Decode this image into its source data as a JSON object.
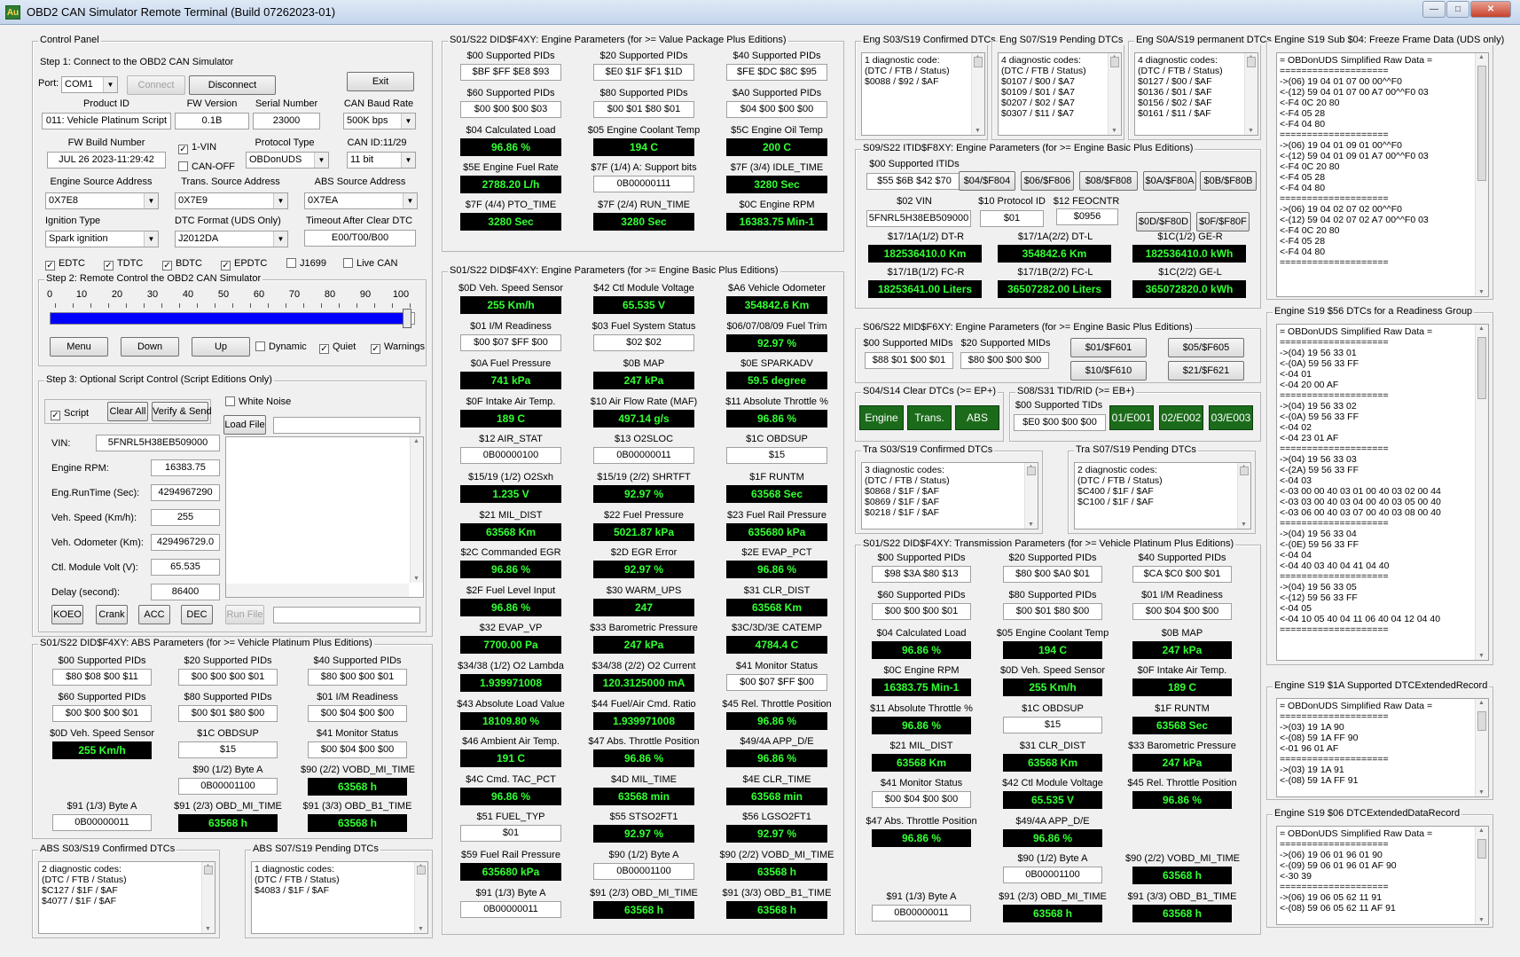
{
  "window": {
    "title": "OBD2 CAN Simulator Remote Terminal (Build 07262023-01)",
    "icon": "Au",
    "min": "—",
    "max": "□",
    "close": "✕"
  },
  "control": {
    "title": "Control Panel",
    "step1": "Step 1: Connect to the OBD2 CAN Simulator",
    "port_label": "Port:",
    "port_value": "COM1",
    "connect": "Connect",
    "disconnect": "Disconnect",
    "exit": "Exit",
    "product_id_label": "Product ID",
    "product_id": "011: Vehicle Platinum Script",
    "fw_version_label": "FW Version",
    "fw_version": "0.1B",
    "serial_label": "Serial Number",
    "serial": "23000",
    "baud_label": "CAN Baud Rate",
    "baud": "500K bps",
    "fw_build_label": "FW Build Number",
    "fw_build": "JUL 26 2023-11:29:42",
    "vin1": "1-VIN",
    "canoff": "CAN-OFF",
    "protocol_label": "Protocol Type",
    "protocol": "OBDonUDS",
    "canid_label": "CAN ID:11/29",
    "canid": "11 bit",
    "eng_src_label": "Engine Source Address",
    "eng_src": "0X7E8",
    "trans_src_label": "Trans. Source Address",
    "trans_src": "0X7E9",
    "abs_src_label": "ABS Source Address",
    "abs_src": "0X7EA",
    "ign_label": "Ignition Type",
    "ign": "Spark ignition",
    "dtc_fmt_label": "DTC Format (UDS Only)",
    "dtc_fmt": "J2012DA",
    "timeout_label": "Timeout After Clear DTC",
    "timeout": "E00/T00/B00",
    "checks": [
      {
        "label": "EDTC",
        "on": true
      },
      {
        "label": "TDTC",
        "on": true
      },
      {
        "label": "BDTC",
        "on": true
      },
      {
        "label": "EPDTC",
        "on": true
      },
      {
        "label": "J1699",
        "on": false
      },
      {
        "label": "Live CAN",
        "on": false
      }
    ],
    "step2": "Step 2: Remote Control the OBD2 CAN Simulator",
    "ticks": [
      "0",
      "10",
      "20",
      "30",
      "40",
      "50",
      "60",
      "70",
      "80",
      "90",
      "100"
    ],
    "slider_value": 98,
    "menu": "Menu",
    "down": "Down",
    "up": "Up",
    "dynamic": "Dynamic",
    "quiet": "Quiet",
    "warnings": "Warnings",
    "step3": "Step 3: Optional Script Control (Script Editions Only)",
    "white_noise": "White Noise",
    "script": "Script",
    "clear_all": "Clear All",
    "verify_send": "Verify & Send",
    "load_file": "Load File",
    "vin_label": "VIN:",
    "vin": "5FNRL5H38EB509000",
    "rpm_label": "Engine RPM:",
    "rpm": "16383.75",
    "runtime_label": "Eng.RunTime (Sec):",
    "runtime": "4294967290",
    "speed_label": "Veh. Speed (Km/h):",
    "speed": "255",
    "odo_label": "Veh. Odometer (Km):",
    "odo": "429496729.0",
    "ctl_label": "Ctl. Module Volt (V):",
    "ctl": "65.535",
    "delay_label": "Delay (second):",
    "delay": "86400",
    "koeo": "KOEO",
    "crank": "Crank",
    "acc": "ACC",
    "dec": "DEC",
    "run_file": "Run File"
  },
  "abs": {
    "title": "S01/S22 DID$F4XY: ABS Parameters (for >= Vehicle Platinum Plus Editions)",
    "cells": [
      {
        "l": "$00 Supported PIDs",
        "v": "$80 $08 $00 $11",
        "g": false
      },
      {
        "l": "$20 Supported PIDs",
        "v": "$00 $00 $00 $01",
        "g": false
      },
      {
        "l": "$40 Supported PIDs",
        "v": "$80 $00 $00 $01",
        "g": false
      },
      {
        "l": "$60 Supported PIDs",
        "v": "$00 $00 $00 $01",
        "g": false
      },
      {
        "l": "$80 Supported PIDs",
        "v": "$00 $01 $80 $00",
        "g": false
      },
      {
        "l": "$01 I/M Readiness",
        "v": "$00 $04 $00 $00",
        "g": false
      },
      {
        "l": "$0D Veh. Speed Sensor",
        "v": "255 Km/h",
        "g": true
      },
      {
        "l": "$1C OBDSUP",
        "v": "$15",
        "g": false
      },
      {
        "l": "$41 Monitor Status",
        "v": "$00 $04 $00 $00",
        "g": false
      },
      {
        "l": "",
        "v": "",
        "g": false
      },
      {
        "l": "$90 (1/2) Byte A",
        "v": "0B00001100",
        "g": false
      },
      {
        "l": "$90 (2/2) VOBD_MI_TIME",
        "v": "63568 h",
        "g": true
      },
      {
        "l": "$91 (1/3) Byte A",
        "v": "0B00000011",
        "g": false
      },
      {
        "l": "$91 (2/3) OBD_MI_TIME",
        "v": "63568 h",
        "g": true
      },
      {
        "l": "$91 (3/3) OBD_B1_TIME",
        "v": "63568 h",
        "g": true
      }
    ],
    "confirmed_title": "ABS S03/S19 Confirmed DTCs",
    "confirmed": "2 diagnostic codes:\n(DTC / FTB / Status)\n$C127 / $1F / $AF\n$4077 / $1F / $AF",
    "pending_title": "ABS S07/S19 Pending DTCs",
    "pending": "1 diagnostic codes:\n(DTC / FTB / Status)\n$4083 / $1F / $AF"
  },
  "value_pkg": {
    "title": "S01/S22 DID$F4XY: Engine Parameters (for >= Value Package Plus Editions)",
    "cells": [
      {
        "l": "$00 Supported PIDs",
        "v": "$BF $FF $E8 $93",
        "g": false
      },
      {
        "l": "$20 Supported PIDs",
        "v": "$E0 $1F $F1 $1D",
        "g": false
      },
      {
        "l": "$40 Supported PIDs",
        "v": "$FE $DC $8C $95",
        "g": false
      },
      {
        "l": "$60 Supported PIDs",
        "v": "$00 $00 $00 $03",
        "g": false
      },
      {
        "l": "$80 Supported PIDs",
        "v": "$00 $01 $80 $01",
        "g": false
      },
      {
        "l": "$A0 Supported PIDs",
        "v": "$04 $00 $00 $00",
        "g": false
      },
      {
        "l": "$04 Calculated Load",
        "v": "96.86 %",
        "g": true
      },
      {
        "l": "$05 Engine Coolant Temp",
        "v": "194 C",
        "g": true
      },
      {
        "l": "$5C Engine Oil Temp",
        "v": "200 C",
        "g": true
      },
      {
        "l": "$5E Engine Fuel Rate",
        "v": "2788.20 L/h",
        "g": true
      },
      {
        "l": "$7F (1/4) A: Support bits",
        "v": "0B00000111",
        "g": false
      },
      {
        "l": "$7F (3/4) IDLE_TIME",
        "v": "3280 Sec",
        "g": true
      },
      {
        "l": "$7F (4/4) PTO_TIME",
        "v": "3280 Sec",
        "g": true
      },
      {
        "l": "$7F (2/4) RUN_TIME",
        "v": "3280 Sec",
        "g": true
      },
      {
        "l": "$0C Engine RPM",
        "v": "16383.75 Min-1",
        "g": true
      }
    ]
  },
  "basic": {
    "title": "S01/S22 DID$F4XY: Engine Parameters (for >= Engine Basic Plus Editions)",
    "cells": [
      {
        "l": "$0D Veh. Speed Sensor",
        "v": "255 Km/h",
        "g": true
      },
      {
        "l": "$42 Ctl Module Voltage",
        "v": "65.535 V",
        "g": true
      },
      {
        "l": "$A6 Vehicle Odometer",
        "v": "354842.6 Km",
        "g": true
      },
      {
        "l": "$01 I/M Readiness",
        "v": "$00 $07 $FF $00",
        "g": false
      },
      {
        "l": "$03 Fuel System Status",
        "v": "$02 $02",
        "g": false
      },
      {
        "l": "$06/07/08/09 Fuel Trim",
        "v": "92.97 %",
        "g": true
      },
      {
        "l": "$0A Fuel Pressure",
        "v": "741 kPa",
        "g": true
      },
      {
        "l": "$0B MAP",
        "v": "247 kPa",
        "g": true
      },
      {
        "l": "$0E SPARKADV",
        "v": "59.5 degree",
        "g": true
      },
      {
        "l": "$0F Intake Air Temp.",
        "v": "189 C",
        "g": true
      },
      {
        "l": "$10 Air Flow Rate (MAF)",
        "v": "497.14 g/s",
        "g": true
      },
      {
        "l": "$11 Absolute Throttle %",
        "v": "96.86 %",
        "g": true
      },
      {
        "l": "$12 AIR_STAT",
        "v": "0B00000100",
        "g": false
      },
      {
        "l": "$13 O2SLOC",
        "v": "0B00000011",
        "g": false
      },
      {
        "l": "$1C OBDSUP",
        "v": "$15",
        "g": false
      },
      {
        "l": "$15/19 (1/2) O2Sxh",
        "v": "1.235 V",
        "g": true
      },
      {
        "l": "$15/19 (2/2) SHRTFT",
        "v": "92.97 %",
        "g": true
      },
      {
        "l": "$1F RUNTM",
        "v": "63568 Sec",
        "g": true
      },
      {
        "l": "$21 MIL_DIST",
        "v": "63568 Km",
        "g": true
      },
      {
        "l": "$22 Fuel Pressure",
        "v": "5021.87 kPa",
        "g": true
      },
      {
        "l": "$23 Fuel Rail Pressure",
        "v": "635680 kPa",
        "g": true
      },
      {
        "l": "$2C Commanded EGR",
        "v": "96.86 %",
        "g": true
      },
      {
        "l": "$2D EGR Error",
        "v": "92.97 %",
        "g": true
      },
      {
        "l": "$2E EVAP_PCT",
        "v": "96.86 %",
        "g": true
      },
      {
        "l": "$2F Fuel Level Input",
        "v": "96.86 %",
        "g": true
      },
      {
        "l": "$30 WARM_UPS",
        "v": "247",
        "g": true
      },
      {
        "l": "$31 CLR_DIST",
        "v": "63568 Km",
        "g": true
      },
      {
        "l": "$32 EVAP_VP",
        "v": "7700.00 Pa",
        "g": true
      },
      {
        "l": "$33 Barometric Pressure",
        "v": "247 kPa",
        "g": true
      },
      {
        "l": "$3C/3D/3E CATEMP",
        "v": "4784.4 C",
        "g": true
      },
      {
        "l": "$34/38 (1/2) O2 Lambda",
        "v": "1.939971008",
        "g": true
      },
      {
        "l": "$34/38 (2/2) O2 Current",
        "v": "120.3125000 mA",
        "g": true
      },
      {
        "l": "$41 Monitor Status",
        "v": "$00 $07 $FF $00",
        "g": false
      },
      {
        "l": "$43 Absolute Load Value",
        "v": "18109.80 %",
        "g": true
      },
      {
        "l": "$44 Fuel/Air Cmd. Ratio",
        "v": "1.939971008",
        "g": true
      },
      {
        "l": "$45 Rel. Throttle Position",
        "v": "96.86 %",
        "g": true
      },
      {
        "l": "$46 Ambient Air Temp.",
        "v": "191 C",
        "g": true
      },
      {
        "l": "$47 Abs. Throttle Position",
        "v": "96.86 %",
        "g": true
      },
      {
        "l": "$49/4A APP_D/E",
        "v": "96.86 %",
        "g": true
      },
      {
        "l": "$4C Cmd. TAC_PCT",
        "v": "96.86 %",
        "g": true
      },
      {
        "l": "$4D MIL_TIME",
        "v": "63568 min",
        "g": true
      },
      {
        "l": "$4E CLR_TIME",
        "v": "63568 min",
        "g": true
      },
      {
        "l": "$51 FUEL_TYP",
        "v": "$01",
        "g": false
      },
      {
        "l": "$55 STSO2FT1",
        "v": "92.97 %",
        "g": true
      },
      {
        "l": "$56 LGSO2FT1",
        "v": "92.97 %",
        "g": true
      },
      {
        "l": "$59 Fuel Rail Pressure",
        "v": "635680 kPa",
        "g": true
      },
      {
        "l": "$90 (1/2) Byte A",
        "v": "0B00001100",
        "g": false
      },
      {
        "l": "$90 (2/2) VOBD_MI_TIME",
        "v": "63568 h",
        "g": true
      },
      {
        "l": "$91 (1/3) Byte A",
        "v": "0B00000011",
        "g": false
      },
      {
        "l": "$91 (2/3) OBD_MI_TIME",
        "v": "63568 h",
        "g": true
      },
      {
        "l": "$91 (3/3) OBD_B1_TIME",
        "v": "63568 h",
        "g": true
      }
    ]
  },
  "eng_dtc": {
    "confirmed_title": "Eng S03/S19 Confirmed DTCs",
    "confirmed": "1 diagnostic code:\n(DTC / FTB / Status)\n$0088 / $92 / $AF",
    "pending_title": "Eng S07/S19 Pending DTCs",
    "pending": "4 diagnostic codes:\n(DTC / FTB / Status)\n$0107 / $00 / $A7\n$0109 / $01 / $A7\n$0207 / $02 / $A7\n$0307 / $11 / $A7",
    "perm_title": "Eng S0A/S19 permanent DTCs",
    "perm": "4 diagnostic codes:\n(DTC / FTB / Status)\n$0127 / $00 / $AF\n$0136 / $01 / $AF\n$0156 / $02 / $AF\n$0161 / $11 / $AF"
  },
  "itid": {
    "title": "S09/S22 ITID$F8XY: Engine Parameters (for >= Engine Basic Plus Editions)",
    "sup_label": "$00 Supported ITIDs",
    "sup": "$55 $6B $42 $70",
    "btns": [
      "$04/$F804",
      "$06/$F806",
      "$08/$F808",
      "$0A/$F80A",
      "$0B/$F80B"
    ],
    "vin_label": "$02 VIN",
    "vin": "5FNRL5H38EB509000",
    "proto_label": "$10 Protocol ID",
    "proto": "$01",
    "feo_label": "$12 FEOCNTR",
    "feo": "$0956",
    "btns2": [
      "$0D/$F80D",
      "$0F/$F80F"
    ],
    "cells": [
      {
        "l": "$17/1A(1/2) DT-R",
        "v": "182536410.0 Km"
      },
      {
        "l": "$17/1A(2/2) DT-L",
        "v": "354842.6 Km"
      },
      {
        "l": "$1C(1/2) GE-R",
        "v": "182536410.0 kWh"
      },
      {
        "l": "$17/1B(1/2) FC-R",
        "v": "18253641.00 Liters"
      },
      {
        "l": "$17/1B(2/2) FC-L",
        "v": "36507282.00 Liters"
      },
      {
        "l": "$1C(2/2) GE-L",
        "v": "365072820.0 kWh"
      }
    ]
  },
  "mid": {
    "title": "S06/S22 MID$F6XY: Engine Parameters (for >= Engine Basic Plus Editions)",
    "sup00_label": "$00 Supported MIDs",
    "sup00": "$88 $01 $00 $01",
    "sup20_label": "$20 Supported MIDs",
    "sup20": "$80 $00 $00 $00",
    "btns": [
      "$01/$F601",
      "$05/$F605",
      "$10/$F610",
      "$21/$F621"
    ]
  },
  "s04": {
    "title": "S04/S14 Clear DTCs (>= EP+)",
    "engine": "Engine",
    "trans": "Trans.",
    "abs": "ABS"
  },
  "s08": {
    "title": "S08/S31 TID/RID (>= EB+)",
    "sup_label": "$00 Supported TIDs",
    "sup": "$E0 $00 $00 $00",
    "btns": [
      "01/E001",
      "02/E002",
      "03/E003"
    ]
  },
  "tra_dtc": {
    "confirmed_title": "Tra S03/S19 Confirmed DTCs",
    "confirmed": "3 diagnostic codes:\n(DTC / FTB / Status)\n$0868 / $1F / $AF\n$0869 / $1F / $AF\n$0218 / $1F / $AF",
    "pending_title": "Tra S07/S19 Pending DTCs",
    "pending": "2 diagnostic codes:\n(DTC / FTB / Status)\n$C400 / $1F / $AF\n$C100 / $1F / $AF"
  },
  "trans": {
    "title": "S01/S22 DID$F4XY: Transmission Parameters (for >= Vehicle Platinum Plus Editions)",
    "cells": [
      {
        "l": "$00 Supported PIDs",
        "v": "$98 $3A $80 $13",
        "g": false
      },
      {
        "l": "$20 Supported PIDs",
        "v": "$80 $00 $A0 $01",
        "g": false
      },
      {
        "l": "$40 Supported PIDs",
        "v": "$CA $C0 $00 $01",
        "g": false
      },
      {
        "l": "$60 Supported PIDs",
        "v": "$00 $00 $00 $01",
        "g": false
      },
      {
        "l": "$80 Supported PIDs",
        "v": "$00 $01 $80 $00",
        "g": false
      },
      {
        "l": "$01 I/M Readiness",
        "v": "$00 $04 $00 $00",
        "g": false
      },
      {
        "l": "$04 Calculated Load",
        "v": "96.86 %",
        "g": true
      },
      {
        "l": "$05 Engine Coolant Temp",
        "v": "194 C",
        "g": true
      },
      {
        "l": "$0B MAP",
        "v": "247 kPa",
        "g": true
      },
      {
        "l": "$0C Engine RPM",
        "v": "16383.75 Min-1",
        "g": true
      },
      {
        "l": "$0D Veh. Speed Sensor",
        "v": "255 Km/h",
        "g": true
      },
      {
        "l": "$0F Intake Air Temp.",
        "v": "189 C",
        "g": true
      },
      {
        "l": "$11 Absolute Throttle %",
        "v": "96.86 %",
        "g": true
      },
      {
        "l": "$1C OBDSUP",
        "v": "$15",
        "g": false
      },
      {
        "l": "$1F RUNTM",
        "v": "63568 Sec",
        "g": true
      },
      {
        "l": "$21 MIL_DIST",
        "v": "63568 Km",
        "g": true
      },
      {
        "l": "$31 CLR_DIST",
        "v": "63568 Km",
        "g": true
      },
      {
        "l": "$33 Barometric Pressure",
        "v": "247 kPa",
        "g": true
      },
      {
        "l": "$41 Monitor Status",
        "v": "$00 $04 $00 $00",
        "g": false
      },
      {
        "l": "$42 Ctl Module Voltage",
        "v": "65.535 V",
        "g": true
      },
      {
        "l": "$45 Rel. Throttle Position",
        "v": "96.86 %",
        "g": true
      },
      {
        "l": "$47 Abs. Throttle Position",
        "v": "96.86 %",
        "g": true
      },
      {
        "l": "$49/4A APP_D/E",
        "v": "96.86 %",
        "g": true
      },
      {
        "l": "",
        "v": "",
        "g": false
      },
      {
        "l": "",
        "v": "",
        "g": false
      },
      {
        "l": "$90 (1/2) Byte A",
        "v": "0B00001100",
        "g": false
      },
      {
        "l": "$90 (2/2) VOBD_MI_TIME",
        "v": "63568 h",
        "g": true
      },
      {
        "l": "$91 (1/3) Byte A",
        "v": "0B00000011",
        "g": false
      },
      {
        "l": "$91 (2/3) OBD_MI_TIME",
        "v": "63568 h",
        "g": true
      },
      {
        "l": "$91 (3/3) OBD_B1_TIME",
        "v": "63568 h",
        "g": true
      }
    ]
  },
  "right": {
    "ff_title": "Engine S19 Sub $04: Freeze Frame Data (UDS only)",
    "ff": "= OBDonUDS Simplified Raw Data =\n====================\n->(06) 19 04 01 07 00 00^^F0\n<-(12) 59 04 01 07 00 A7 00^^F0 03\n<-F4 0C 20 80\n<-F4 05 28\n<-F4 04 80\n====================\n->(06) 19 04 01 09 01 00^^F0\n<-(12) 59 04 01 09 01 A7 00^^F0 03\n<-F4 0C 20 80\n<-F4 05 28\n<-F4 04 80\n====================\n->(06) 19 04 02 07 02 00^^F0\n<-(12) 59 04 02 07 02 A7 00^^F0 03\n<-F4 0C 20 80\n<-F4 05 28\n<-F4 04 80\n====================",
    "rd_title": "Engine S19 $56 DTCs for a Readiness Group",
    "rd": "= OBDonUDS Simplified Raw Data =\n====================\n->(04) 19 56 33 01\n<-(0A) 59 56 33 FF\n<-04 01\n<-04 20 00 AF\n====================\n->(04) 19 56 33 02\n<-(0A) 59 56 33 FF\n<-04 02\n<-04 23 01 AF\n====================\n->(04) 19 56 33 03\n<-(2A) 59 56 33 FF\n<-04 03\n<-03 00 00 40 03 01 00 40 03 02 00 44\n<-03 03 00 40 03 04 00 40 03 05 00 40\n<-03 06 00 40 03 07 00 40 03 08 00 40\n====================\n->(04) 19 56 33 04\n<-(0E) 59 56 33 FF\n<-04 04\n<-04 40 03 40 04 41 04 40\n====================\n->(04) 19 56 33 05\n<-(12) 59 56 33 FF\n<-04 05\n<-04 10 05 40 04 11 06 40 04 12 04 40\n====================",
    "ext_title": "Engine S19 $1A Supported DTCExtendedRecord",
    "ext": "= OBDonUDS Simplified Raw Data =\n====================\n->(03) 19 1A 90\n<-(08) 59 1A FF 90\n<-01 96 01 AF\n====================\n->(03) 19 1A 91\n<-(08) 59 1A FF 91",
    "s06_title": "Engine S19 $06 DTCExtendedDataRecord",
    "s06": "= OBDonUDS Simplified Raw Data =\n====================\n->(06) 19 06 01 96 01 90\n<-(09) 59 06 01 96 01 AF 90\n<-30 39\n====================\n->(06) 19 06 05 62 11 91\n<-(08) 59 06 05 62 11 AF 91"
  }
}
